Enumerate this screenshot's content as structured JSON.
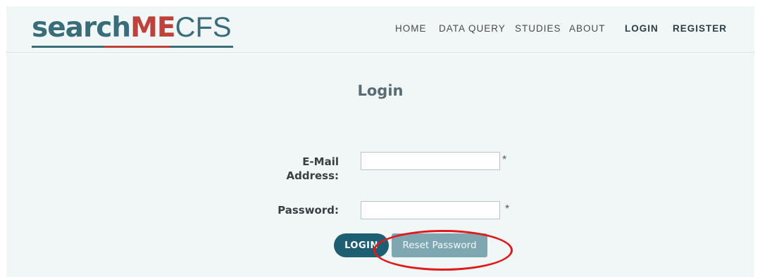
{
  "logo": {
    "part1": "search",
    "part2": "ME",
    "part3": "CFS"
  },
  "nav": {
    "home": "HOME",
    "data_query": "DATA QUERY",
    "studies": "STUDIES",
    "about": "ABOUT",
    "login": "LOGIN",
    "register": "REGISTER"
  },
  "page": {
    "title": "Login"
  },
  "form": {
    "email_label_line1": "E-Mail",
    "email_label_line2": "Address:",
    "email_value": "",
    "password_label": "Password:",
    "password_value": "",
    "required_mark": "*",
    "login_button": "LOGIN",
    "reset_button": "Reset Password"
  },
  "colors": {
    "brand_teal": "#3a6d7a",
    "brand_red": "#c0413a",
    "login_button": "#1e5e73",
    "reset_button": "#7fa7b1",
    "annotation": "#e0191b"
  }
}
